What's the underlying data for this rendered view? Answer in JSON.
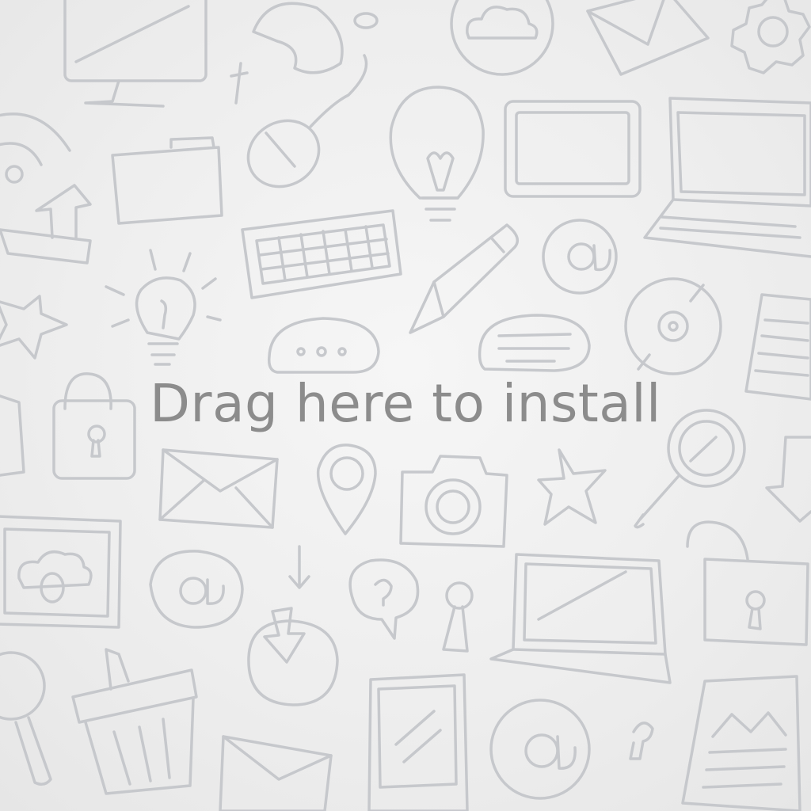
{
  "drop_zone": {
    "hint_text": "Drag here to install"
  },
  "colors": {
    "background": "#eeeeee",
    "doodle_stroke": "#c6c8cc",
    "hint_text": "#8c8c8c"
  },
  "icons": [
    "monitor-icon",
    "profile-doodle-icon",
    "cloud-circle-icon",
    "envelope-icon",
    "gear-icon",
    "wifi-icon",
    "folder-icon",
    "mouse-icon",
    "lightbulb-icon",
    "tablet-icon",
    "laptop-icon",
    "upload-arrow-icon",
    "keyboard-icon",
    "pencil-icon",
    "at-sign-icon",
    "idea-bulb-icon",
    "chat-bubble-icon",
    "speech-bubble-icon",
    "disc-icon",
    "document-icon",
    "star-icon",
    "padlock-icon",
    "mail-icon",
    "map-pin-icon",
    "camera-icon",
    "magnifier-icon",
    "download-arrow-icon",
    "image-frame-icon",
    "email-at-icon",
    "question-bubble-icon",
    "keyhole-icon",
    "laptop-open-icon",
    "unlocked-padlock-icon",
    "download-box-icon",
    "trash-can-icon",
    "letter-icon",
    "smartphone-icon",
    "at-circle-icon",
    "chart-document-icon"
  ]
}
